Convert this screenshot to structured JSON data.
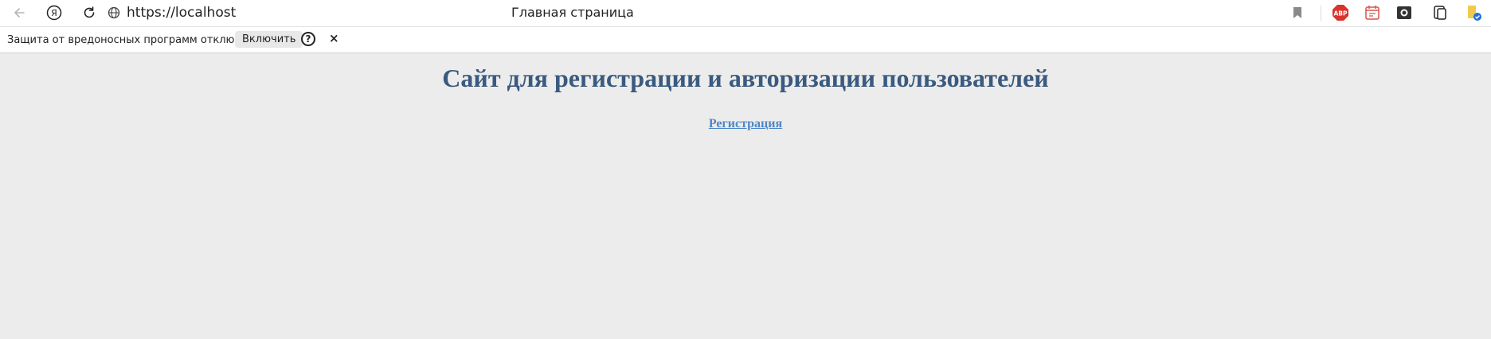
{
  "browser": {
    "url": "https://localhost",
    "tab_title": "Главная страница",
    "extensions": [
      {
        "name": "adblock-icon",
        "label": "ABP"
      }
    ]
  },
  "infobar": {
    "message": "Защита от вредоносных программ отключена",
    "enable_label": "Включить",
    "help_label": "?",
    "close_label": "×"
  },
  "page": {
    "heading": "Сайт для регистрации и авторизации пользователей",
    "register_link": "Регистрация"
  }
}
